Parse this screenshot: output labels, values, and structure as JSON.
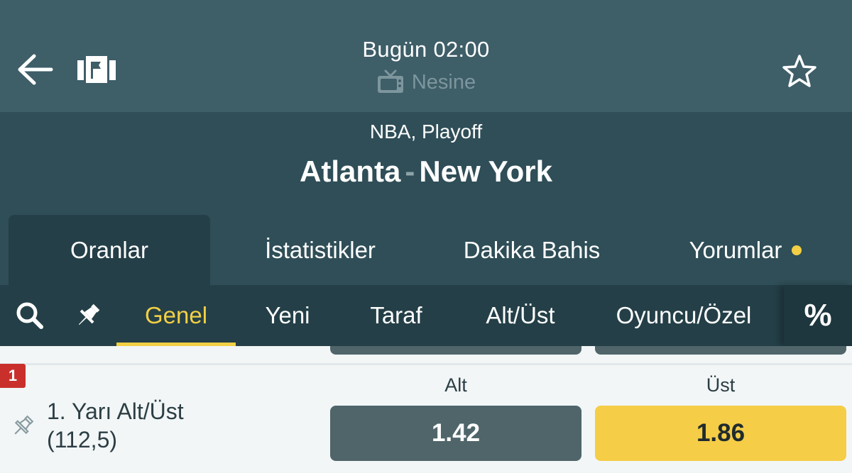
{
  "header": {
    "time": "Bugün 02:00",
    "broadcaster": "Nesine",
    "icons": {
      "back": "arrow-left-icon",
      "stats": "flag-board-icon",
      "tv": "tv-icon",
      "favorite": "star-icon"
    }
  },
  "match": {
    "league": "NBA, Playoff",
    "home_team": "Atlanta",
    "separator": "-",
    "away_team": "New York"
  },
  "main_tabs": [
    {
      "label": "Oranlar",
      "active": true
    },
    {
      "label": "İstatistikler",
      "active": false
    },
    {
      "label": "Dakika Bahis",
      "active": false
    },
    {
      "label": "Yorumlar",
      "active": false,
      "has_dot": true
    }
  ],
  "sub_tabs": [
    {
      "label": "Genel",
      "active": true
    },
    {
      "label": "Yeni",
      "active": false
    },
    {
      "label": "Taraf",
      "active": false
    },
    {
      "label": "Alt/Üst",
      "active": false
    },
    {
      "label": "Oyuncu/Özel",
      "active": false
    }
  ],
  "percent_label": "%",
  "market": {
    "badge": "1",
    "name_line1": "1. Yarı Alt/Üst",
    "name_line2": "(112,5)",
    "columns": [
      "Alt",
      "Üst"
    ],
    "odds": [
      "1.42",
      "1.86"
    ]
  },
  "colors": {
    "header_bg": "#3e5e68",
    "match_bg": "#2f4e57",
    "subbar_bg": "#243f47",
    "accent": "#f3cf45",
    "badge": "#c9302c",
    "odd_dark": "#4f6569",
    "odd_selected": "#f5cd47"
  }
}
